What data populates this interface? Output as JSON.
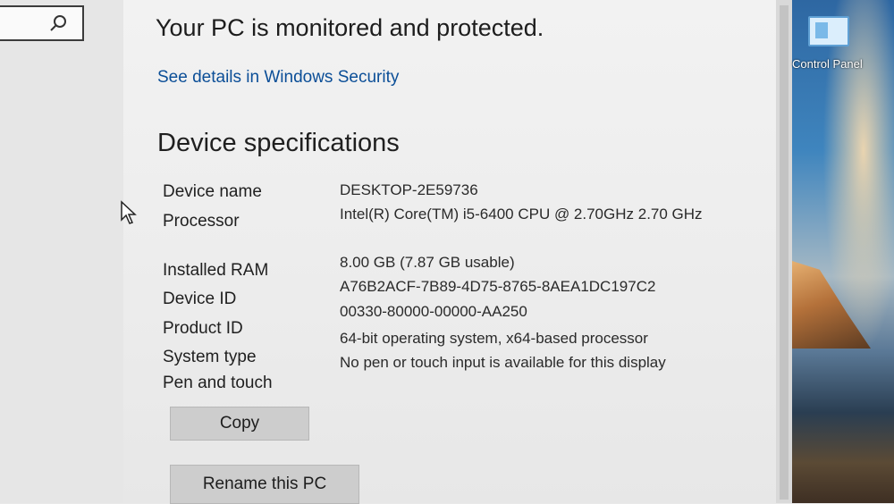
{
  "protection": {
    "status_text": "Your PC is monitored and protected.",
    "details_link": "See details in Windows Security"
  },
  "device_specs": {
    "heading": "Device specifications",
    "rows": [
      {
        "label": "Device name",
        "value": "DESKTOP-2E59736"
      },
      {
        "label": "Processor",
        "value": "Intel(R) Core(TM) i5-6400 CPU @ 2.70GHz   2.70 GHz"
      },
      {
        "label": "Installed RAM",
        "value": "8.00 GB (7.87 GB usable)"
      },
      {
        "label": "Device ID",
        "value": "A76B2ACF-7B89-4D75-8765-8AEA1DC197C2"
      },
      {
        "label": "Product ID",
        "value": "00330-80000-00000-AA250"
      },
      {
        "label": "System type",
        "value": "64-bit operating system, x64-based processor"
      },
      {
        "label": "Pen and touch",
        "value": "No pen or touch input is available for this display"
      }
    ],
    "copy_button": "Copy"
  },
  "rename_button": "Rename this PC",
  "desktop": {
    "icon_label": "Control Panel",
    "icon_name": "control-panel-icon"
  },
  "search": {
    "icon_name": "search-icon"
  },
  "colors": {
    "link": "#0b4e97",
    "background": "#ececec"
  }
}
